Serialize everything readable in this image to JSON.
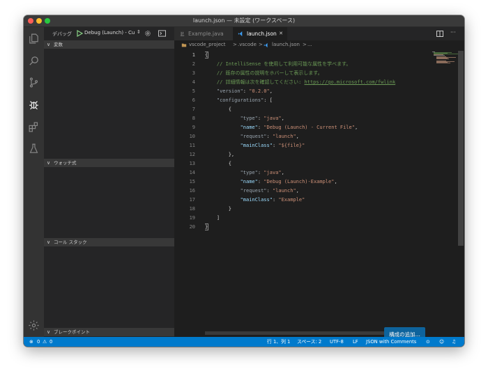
{
  "window": {
    "title": "launch.json — 未設定 (ワークスペース)"
  },
  "activity_bar": {
    "icons": [
      "files-icon",
      "search-icon",
      "source-control-icon",
      "debug-icon",
      "extensions-icon",
      "test-icon",
      "settings-icon"
    ]
  },
  "sidebar": {
    "header_label": "デバッグ",
    "config_name": "Debug (Launch) - Cu",
    "sections": [
      {
        "label": "変数"
      },
      {
        "label": "ウォッチ式"
      },
      {
        "label": "コール スタック"
      },
      {
        "label": "ブレークポイント"
      }
    ]
  },
  "tabs": [
    {
      "label": "Example.java"
    },
    {
      "label": "launch.json"
    }
  ],
  "breadcrumb": {
    "items": [
      "vscode_project",
      ".vscode",
      "launch.json",
      "..."
    ],
    "separator": ">"
  },
  "editor": {
    "line_numbers": [
      "1",
      "2",
      "3",
      "4",
      "5",
      "6",
      "7",
      "8",
      "9",
      "10",
      "11",
      "12",
      "13",
      "14",
      "15",
      "16",
      "17",
      "18",
      "19",
      "20"
    ],
    "lines": [
      {
        "pieces": [
          [
            "br",
            "{"
          ]
        ]
      },
      {
        "pieces": [
          [
            "cm",
            "    // IntelliSense を使用して利用可能な属性を学べます。"
          ]
        ]
      },
      {
        "pieces": [
          [
            "cm",
            "    // 既存の属性の説明をホバーして表示します。"
          ]
        ]
      },
      {
        "pieces": [
          [
            "cm",
            "    // 詳細情報は次を確認してください: "
          ],
          [
            "ln-link",
            "https://go.microsoft.com/fwlink"
          ]
        ]
      },
      {
        "pieces": [
          [
            "kd",
            "    \"version\""
          ],
          [
            "br",
            ": "
          ],
          [
            "s",
            "\"0.2.0\""
          ],
          [
            "br",
            ","
          ]
        ]
      },
      {
        "pieces": [
          [
            "kd",
            "    \"configurations\""
          ],
          [
            "br",
            ": ["
          ]
        ]
      },
      {
        "pieces": [
          [
            "br",
            "        {"
          ]
        ]
      },
      {
        "pieces": [
          [
            "kd",
            "            \"type\""
          ],
          [
            "br",
            ": "
          ],
          [
            "s",
            "\"java\""
          ],
          [
            "br",
            ","
          ]
        ]
      },
      {
        "pieces": [
          [
            "k",
            "            \"name\""
          ],
          [
            "br",
            ": "
          ],
          [
            "s",
            "\"Debug (Launch) - Current File\""
          ],
          [
            "br",
            ","
          ]
        ]
      },
      {
        "pieces": [
          [
            "kd",
            "            \"request\""
          ],
          [
            "br",
            ": "
          ],
          [
            "s",
            "\"launch\""
          ],
          [
            "br",
            ","
          ]
        ]
      },
      {
        "pieces": [
          [
            "k",
            "            \"mainClass\""
          ],
          [
            "br",
            ": "
          ],
          [
            "s",
            "\"${file}\""
          ]
        ]
      },
      {
        "pieces": [
          [
            "br",
            "        },"
          ]
        ]
      },
      {
        "pieces": [
          [
            "br",
            "        {"
          ]
        ]
      },
      {
        "pieces": [
          [
            "kd",
            "            \"type\""
          ],
          [
            "br",
            ": "
          ],
          [
            "s",
            "\"java\""
          ],
          [
            "br",
            ","
          ]
        ]
      },
      {
        "pieces": [
          [
            "k",
            "            \"name\""
          ],
          [
            "br",
            ": "
          ],
          [
            "s",
            "\"Debug (Launch)-Example\""
          ],
          [
            "br",
            ","
          ]
        ]
      },
      {
        "pieces": [
          [
            "kd",
            "            \"request\""
          ],
          [
            "br",
            ": "
          ],
          [
            "s",
            "\"launch\""
          ],
          [
            "br",
            ","
          ]
        ]
      },
      {
        "pieces": [
          [
            "k",
            "            \"mainClass\""
          ],
          [
            "br",
            ": "
          ],
          [
            "s",
            "\"Example\""
          ]
        ]
      },
      {
        "pieces": [
          [
            "br",
            "        }"
          ]
        ]
      },
      {
        "pieces": [
          [
            "br",
            "    ]"
          ]
        ]
      },
      {
        "pieces": [
          [
            "br",
            "}"
          ]
        ]
      }
    ]
  },
  "add_config_button": {
    "label": "構成の追加..."
  },
  "status_bar": {
    "errors": "0",
    "warnings": "0",
    "position": "行 1、列 1",
    "indent": "スペース: 2",
    "encoding": "UTF-8",
    "eol": "LF",
    "language": "JSON with Comments"
  },
  "colors": {
    "accent": "#007acc",
    "button": "#0e639c",
    "comment": "#6a9955",
    "string": "#ce9178",
    "property": "#9cdcfe"
  }
}
